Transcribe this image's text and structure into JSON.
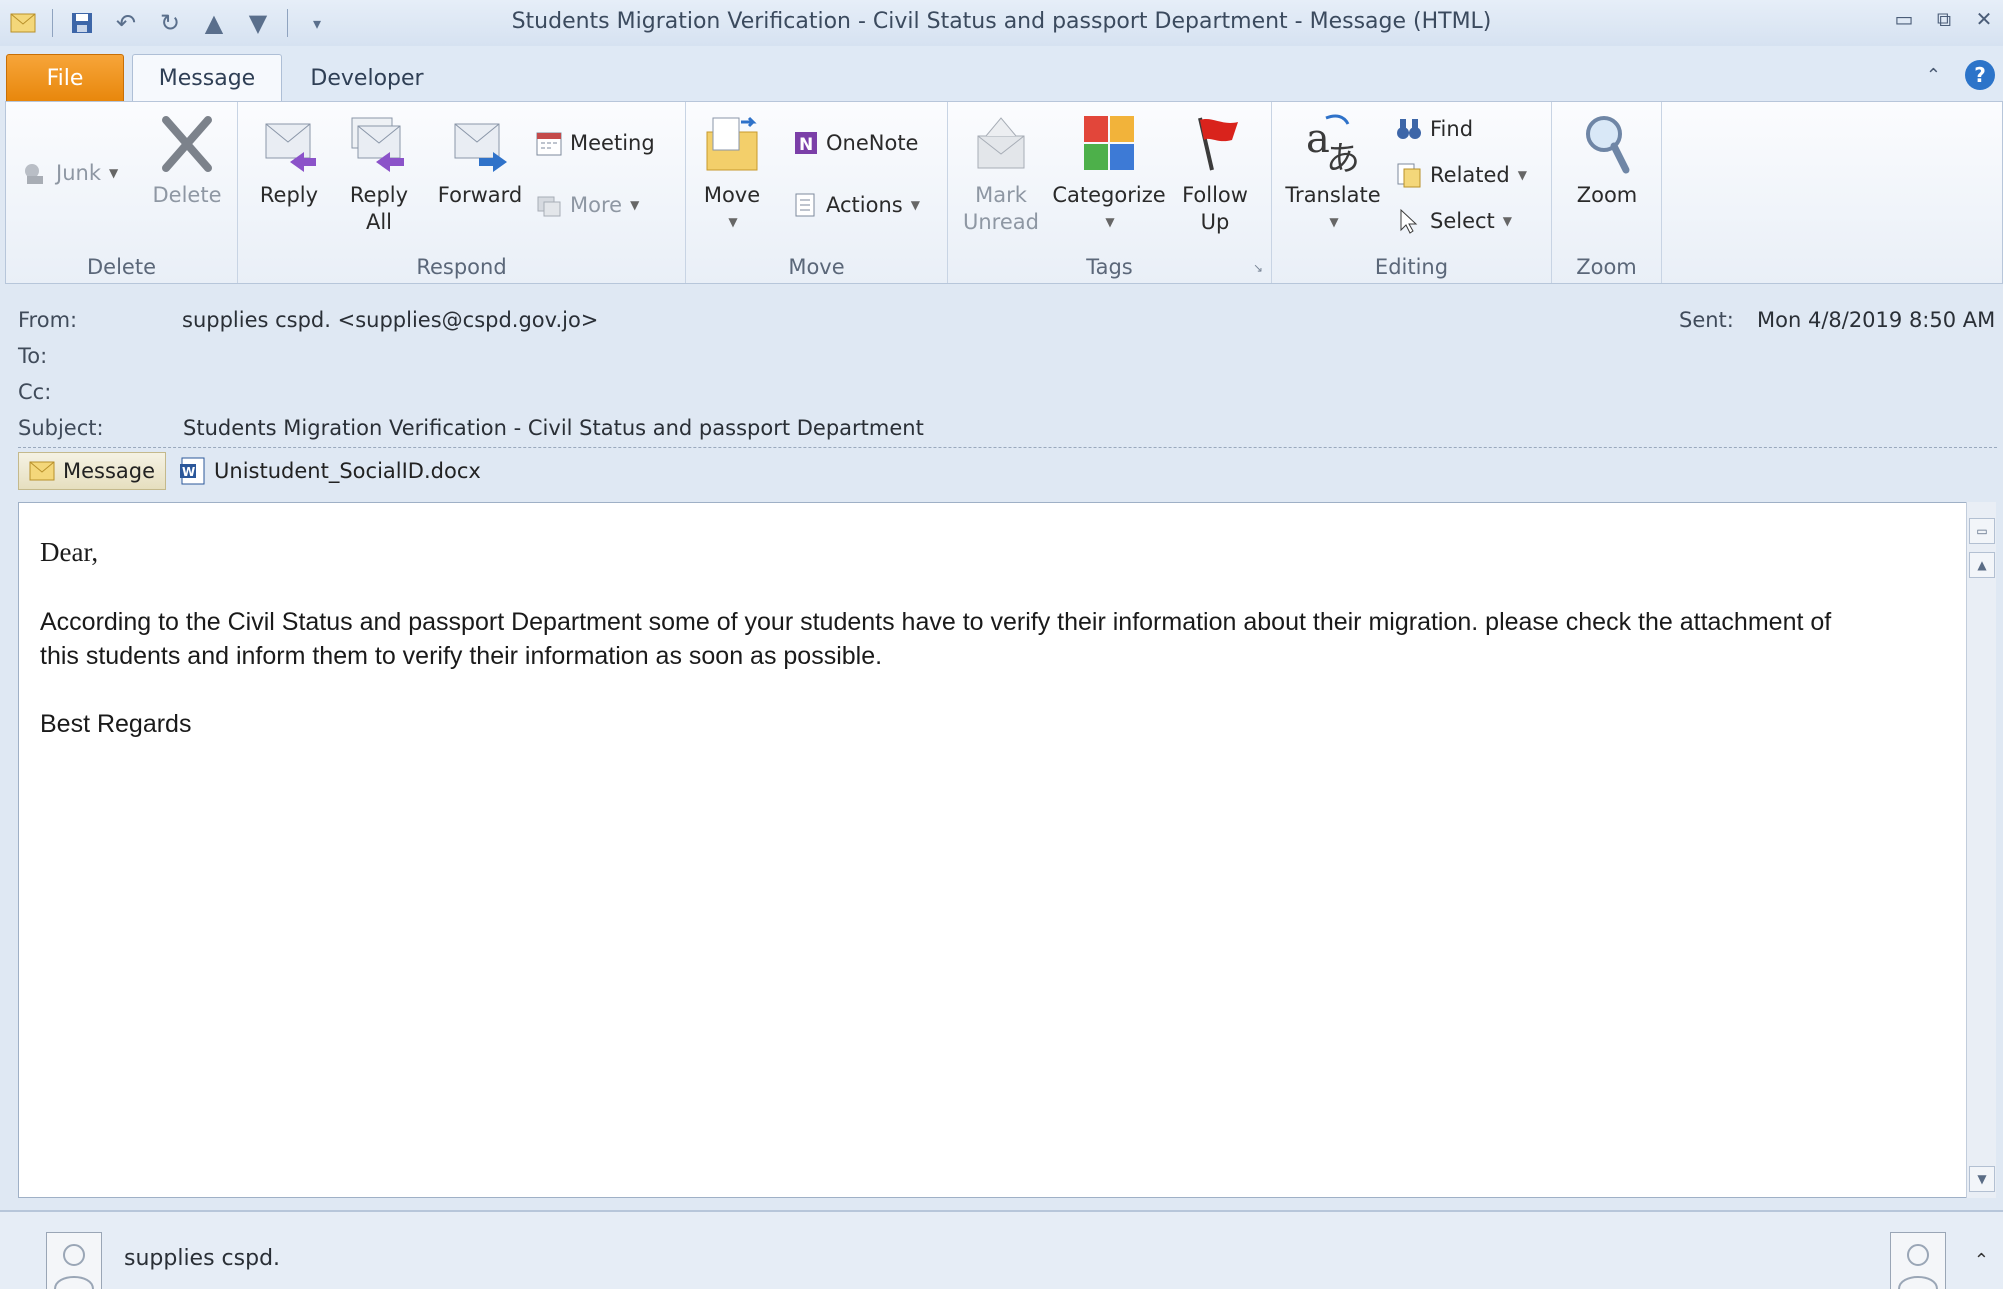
{
  "window": {
    "title": "Students Migration Verification - Civil Status and passport Department -  Message (HTML)"
  },
  "tabs": [
    {
      "label": "File"
    },
    {
      "label": "Message"
    },
    {
      "label": "Developer"
    }
  ],
  "ribbon": {
    "groups": {
      "delete": "Delete",
      "respond": "Respond",
      "move": "Move",
      "tags": "Tags",
      "editing": "Editing",
      "zoom": "Zoom"
    },
    "junk": "Junk",
    "delete": "Delete",
    "reply": "Reply",
    "reply_all_1": "Reply",
    "reply_all_2": "All",
    "forward": "Forward",
    "meeting": "Meeting",
    "more": "More",
    "move": "Move",
    "onenote": "OneNote",
    "actions": "Actions",
    "mark_unread_1": "Mark",
    "mark_unread_2": "Unread",
    "categorize": "Categorize",
    "follow_up_1": "Follow",
    "follow_up_2": "Up",
    "translate": "Translate",
    "find": "Find",
    "related": "Related",
    "select": "Select",
    "zoom": "Zoom"
  },
  "header": {
    "from_label": "From:",
    "from_value": "supplies cspd. <supplies@cspd.gov.jo>",
    "to_label": "To:",
    "cc_label": "Cc:",
    "subject_label": "Subject:",
    "subject_value": "Students Migration Verification - Civil Status and passport Department",
    "sent_label": "Sent:",
    "sent_value": "Mon 4/8/2019 8:50 AM"
  },
  "attachments": {
    "message_tab": "Message",
    "file": "Unistudent_SocialID.docx"
  },
  "body": {
    "greeting": "Dear,",
    "paragraph": "According to the Civil Status and passport Department some of your students have to verify their information about their migration. please check the attachment of this students and inform them to verify their information as soon as possible.",
    "closing": "Best Regards"
  },
  "people_pane": {
    "sender": "supplies cspd."
  },
  "colors": {
    "file_tab": "#e8870c",
    "follow_up_flag": "#d9231c",
    "help": "#2c74c9"
  }
}
